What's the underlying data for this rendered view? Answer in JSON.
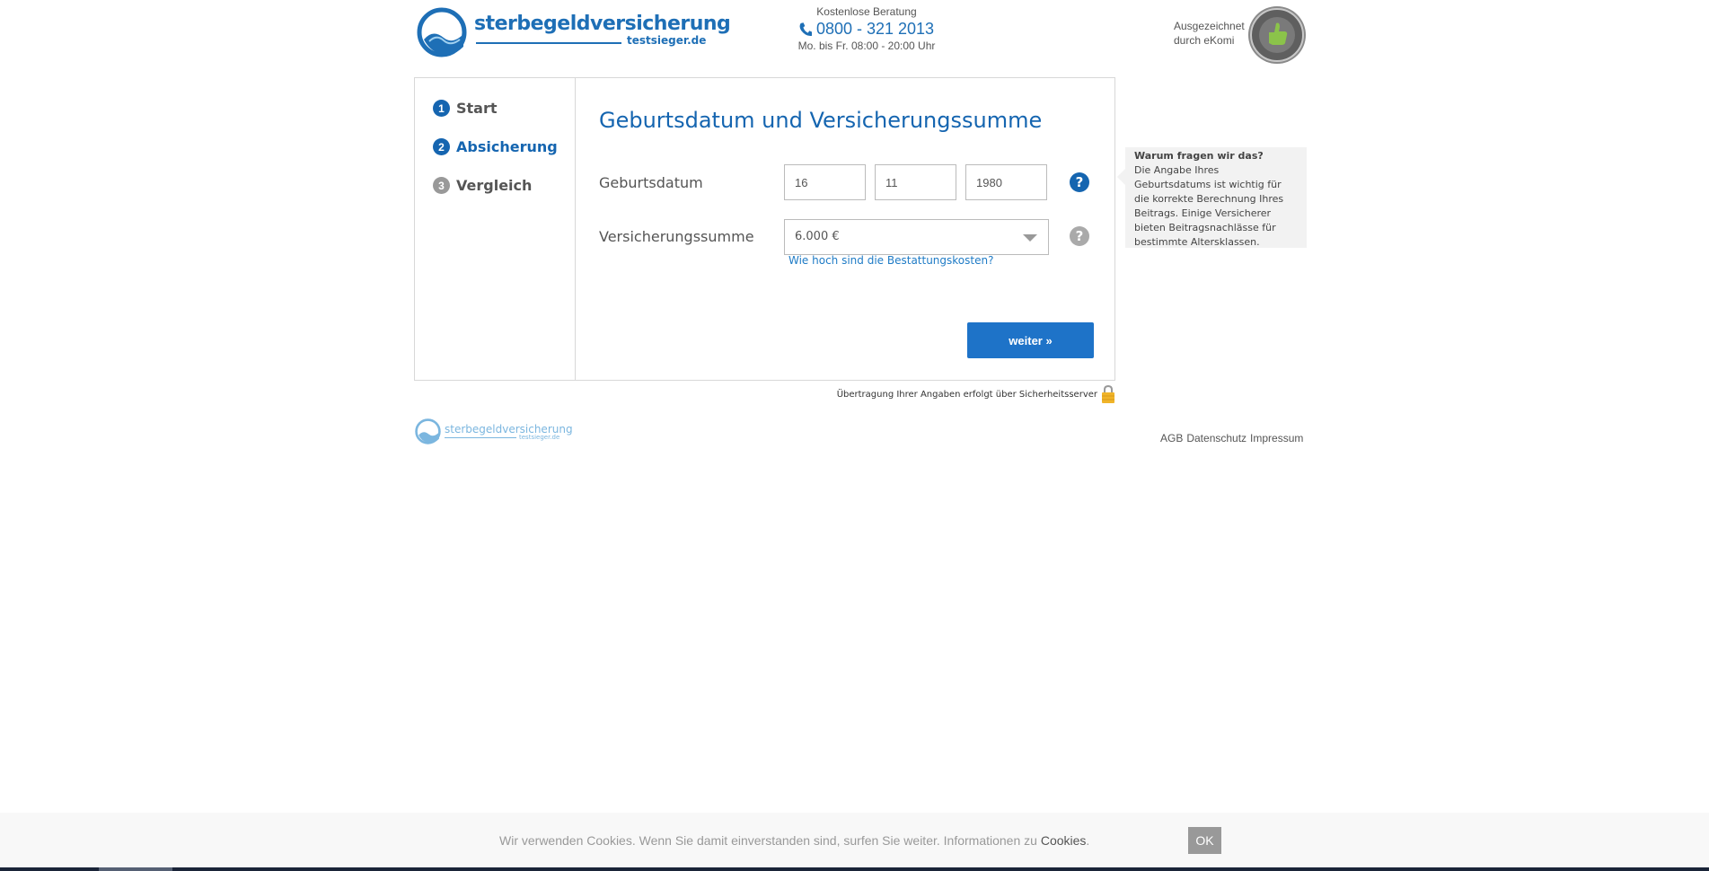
{
  "header": {
    "logo": {
      "brand": "sterbegeldversicherung",
      "sub": "testsieger.de"
    },
    "contact": {
      "label": "Kostenlose Beratung",
      "phone": "0800 - 321 2013",
      "hours": "Mo. bis Fr. 08:00 - 20:00 Uhr"
    },
    "award": {
      "line1": "Ausgezeichnet",
      "line2": "durch eKomi"
    }
  },
  "steps": [
    {
      "num": "1",
      "label": "Start",
      "state": "done"
    },
    {
      "num": "2",
      "label": "Absicherung",
      "state": "active"
    },
    {
      "num": "3",
      "label": "Vergleich",
      "state": "pending"
    }
  ],
  "form": {
    "title": "Geburtsdatum und Versicherungssumme",
    "birthdate": {
      "label": "Geburtsdatum",
      "day": "16",
      "month": "11",
      "year": "1980"
    },
    "sum": {
      "label": "Versicherungssumme",
      "value": "6.000 €",
      "link": "Wie hoch sind die Bestattungskosten?"
    },
    "next_button": "weiter »",
    "help_glyph": "?"
  },
  "info": {
    "title": "Warum fragen wir das?",
    "lines": [
      "Die Angabe Ihres",
      "Geburtsdatums ist wichtig für",
      "die korrekte Berechnung Ihres",
      "Beitrags. Einige Versicherer",
      "bieten Beitragsnachlässe für",
      "bestimmte Altersklassen."
    ]
  },
  "secure_note": "Übertragung Ihrer Angaben erfolgt über Sicherheitsserver",
  "footer": {
    "logo": {
      "brand": "sterbegeldversicherung",
      "sub": "testsieger.de"
    },
    "links": [
      "AGB",
      "Datenschutz",
      "Impressum"
    ]
  },
  "cookie": {
    "text": "Wir verwenden Cookies. Wenn Sie damit einverstanden sind, surfen Sie weiter. Informationen zu",
    "link": "Cookies",
    "ok": "OK"
  },
  "colors": {
    "brand_blue": "#1565b0",
    "button_blue": "#1e73c8",
    "step_done": "#1565b0",
    "step_pending": "#999999",
    "help_active": "#1565b0",
    "help_inactive": "#aaaaaa"
  },
  "icons": {
    "phone": "phone-icon",
    "help": "question-icon",
    "lock": "lock-icon",
    "award": "ekomi-badge-icon",
    "dropdown": "chevron-down-icon"
  }
}
